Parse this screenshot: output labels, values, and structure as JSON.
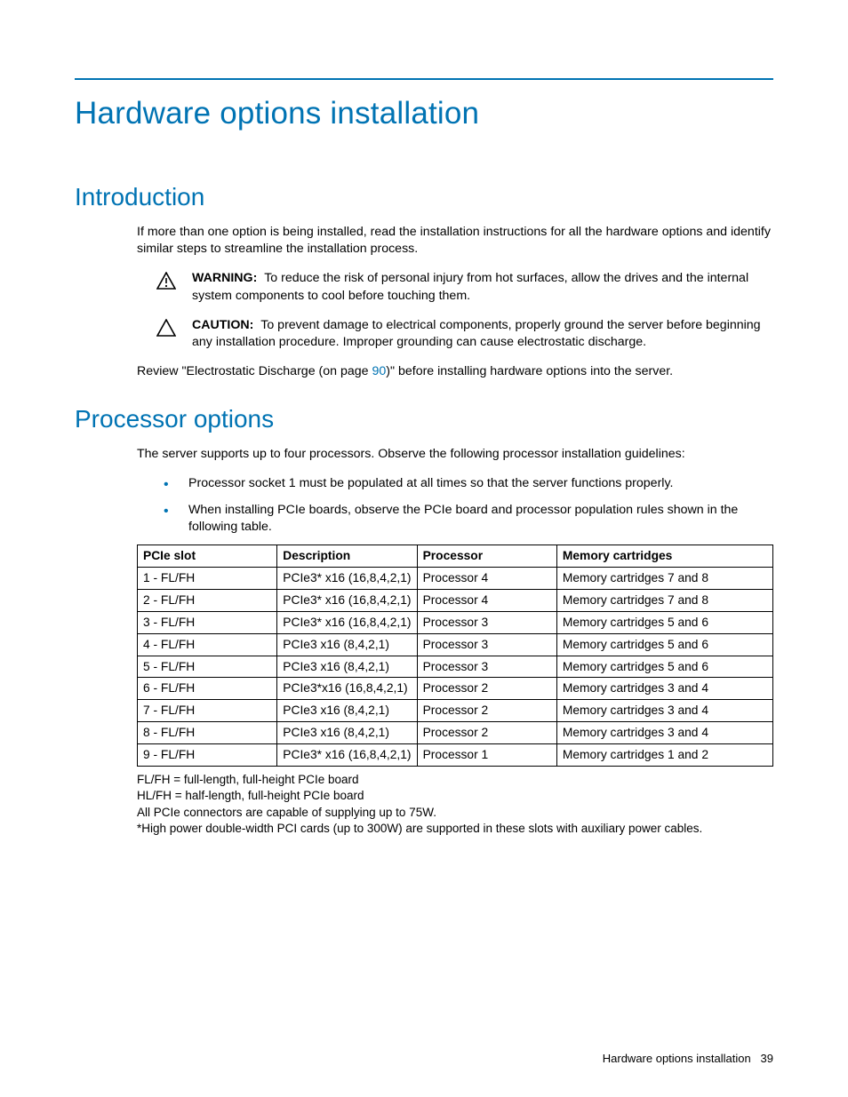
{
  "title": "Hardware options installation",
  "intro_heading": "Introduction",
  "intro_para": "If more than one option is being installed, read the installation instructions for all the hardware options and identify similar steps to streamline the installation process.",
  "warning": {
    "label": "WARNING:",
    "text": "To reduce the risk of personal injury from hot surfaces, allow the drives and the internal system components to cool before touching them."
  },
  "caution": {
    "label": "CAUTION:",
    "text": "To prevent damage to electrical components, properly ground the server before beginning any installation procedure. Improper grounding can cause electrostatic discharge."
  },
  "review_before": "Review \"Electrostatic Discharge (on page ",
  "review_link": "90",
  "review_after": ")\" before installing hardware options into the server.",
  "proc_heading": "Processor options",
  "proc_para": "The server supports up to four processors. Observe the following processor installation guidelines:",
  "bullets": [
    "Processor socket 1 must be populated at all times so that the server functions properly.",
    "When installing PCIe boards, observe the PCIe board and processor population rules shown in the following table."
  ],
  "table": {
    "headers": [
      "PCIe slot",
      "Description",
      "Processor",
      "Memory cartridges"
    ],
    "rows": [
      [
        "1 - FL/FH",
        "PCIe3* x16 (16,8,4,2,1)",
        "Processor 4",
        "Memory cartridges 7 and 8"
      ],
      [
        "2 - FL/FH",
        "PCIe3* x16 (16,8,4,2,1)",
        "Processor 4",
        "Memory cartridges 7 and 8"
      ],
      [
        "3 - FL/FH",
        "PCIe3* x16 (16,8,4,2,1)",
        "Processor 3",
        "Memory cartridges 5 and 6"
      ],
      [
        "4 - FL/FH",
        "PCIe3 x16 (8,4,2,1)",
        "Processor 3",
        "Memory cartridges 5 and 6"
      ],
      [
        "5 - FL/FH",
        "PCIe3 x16 (8,4,2,1)",
        "Processor 3",
        "Memory cartridges 5 and 6"
      ],
      [
        "6 - FL/FH",
        "PCIe3*x16 (16,8,4,2,1)",
        "Processor 2",
        "Memory cartridges 3 and 4"
      ],
      [
        "7 - FL/FH",
        "PCIe3 x16 (8,4,2,1)",
        "Processor 2",
        "Memory cartridges 3 and 4"
      ],
      [
        "8 - FL/FH",
        "PCIe3 x16 (8,4,2,1)",
        "Processor 2",
        "Memory cartridges 3 and 4"
      ],
      [
        "9 - FL/FH",
        "PCIe3* x16 (16,8,4,2,1)",
        "Processor 1",
        "Memory cartridges 1 and 2"
      ]
    ]
  },
  "footnotes": [
    "FL/FH = full-length, full-height PCIe board",
    "HL/FH = half-length, full-height PCIe board",
    "All PCIe connectors are capable of supplying up to 75W.",
    "*High power double-width PCI cards (up to 300W) are supported in these slots with auxiliary power cables."
  ],
  "footer_title": "Hardware options installation",
  "footer_page": "39"
}
